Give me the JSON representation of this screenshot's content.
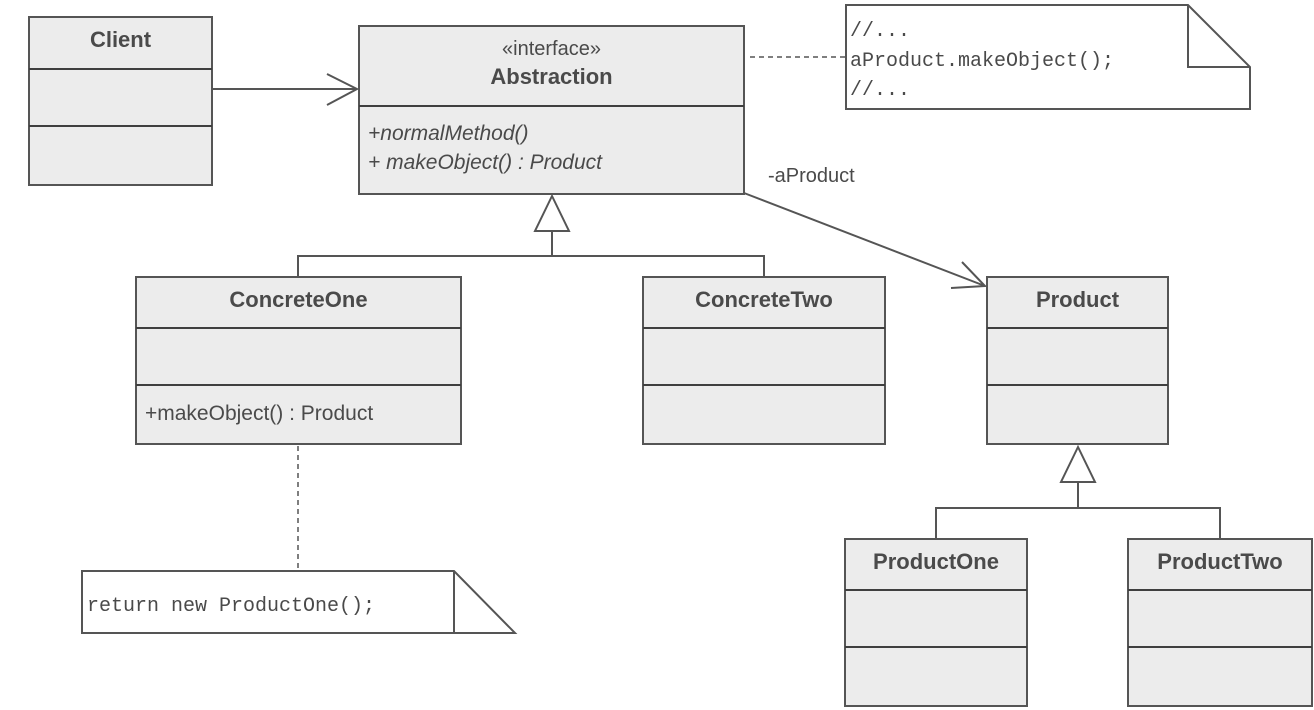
{
  "diagram": {
    "type": "UML class diagram",
    "classes": {
      "client": {
        "name": "Client",
        "attributes": [],
        "operations": []
      },
      "abstraction": {
        "stereotype": "«interface»",
        "name": "Abstraction",
        "operations": [
          "+normalMethod()",
          "+ makeObject() : Product"
        ]
      },
      "concrete_one": {
        "name": "ConcreteOne",
        "attributes": [],
        "operations": [
          "+makeObject() : Product"
        ]
      },
      "concrete_two": {
        "name": "ConcreteTwo",
        "attributes": [],
        "operations": []
      },
      "product": {
        "name": "Product",
        "attributes": [],
        "operations": []
      },
      "product_one": {
        "name": "ProductOne",
        "attributes": [],
        "operations": []
      },
      "product_two": {
        "name": "ProductTwo",
        "attributes": [],
        "operations": []
      }
    },
    "notes": {
      "abstraction_note": {
        "lines": [
          "//...",
          "aProduct.makeObject();",
          "//..."
        ]
      },
      "concrete_one_note": {
        "lines": [
          "return new ProductOne();"
        ]
      }
    },
    "relationships": [
      {
        "type": "association",
        "from": "Client",
        "to": "Abstraction",
        "label": ""
      },
      {
        "type": "association",
        "from": "Abstraction",
        "to": "Product",
        "label": "-aProduct"
      },
      {
        "type": "generalization",
        "from": "ConcreteOne",
        "to": "Abstraction"
      },
      {
        "type": "generalization",
        "from": "ConcreteTwo",
        "to": "Abstraction"
      },
      {
        "type": "generalization",
        "from": "ProductOne",
        "to": "Product"
      },
      {
        "type": "generalization",
        "from": "ProductTwo",
        "to": "Product"
      },
      {
        "type": "note-anchor",
        "from": "Abstraction",
        "to": "abstraction_note"
      },
      {
        "type": "note-anchor",
        "from": "ConcreteOne",
        "to": "concrete_one_note"
      }
    ],
    "association_label": "-aProduct"
  }
}
